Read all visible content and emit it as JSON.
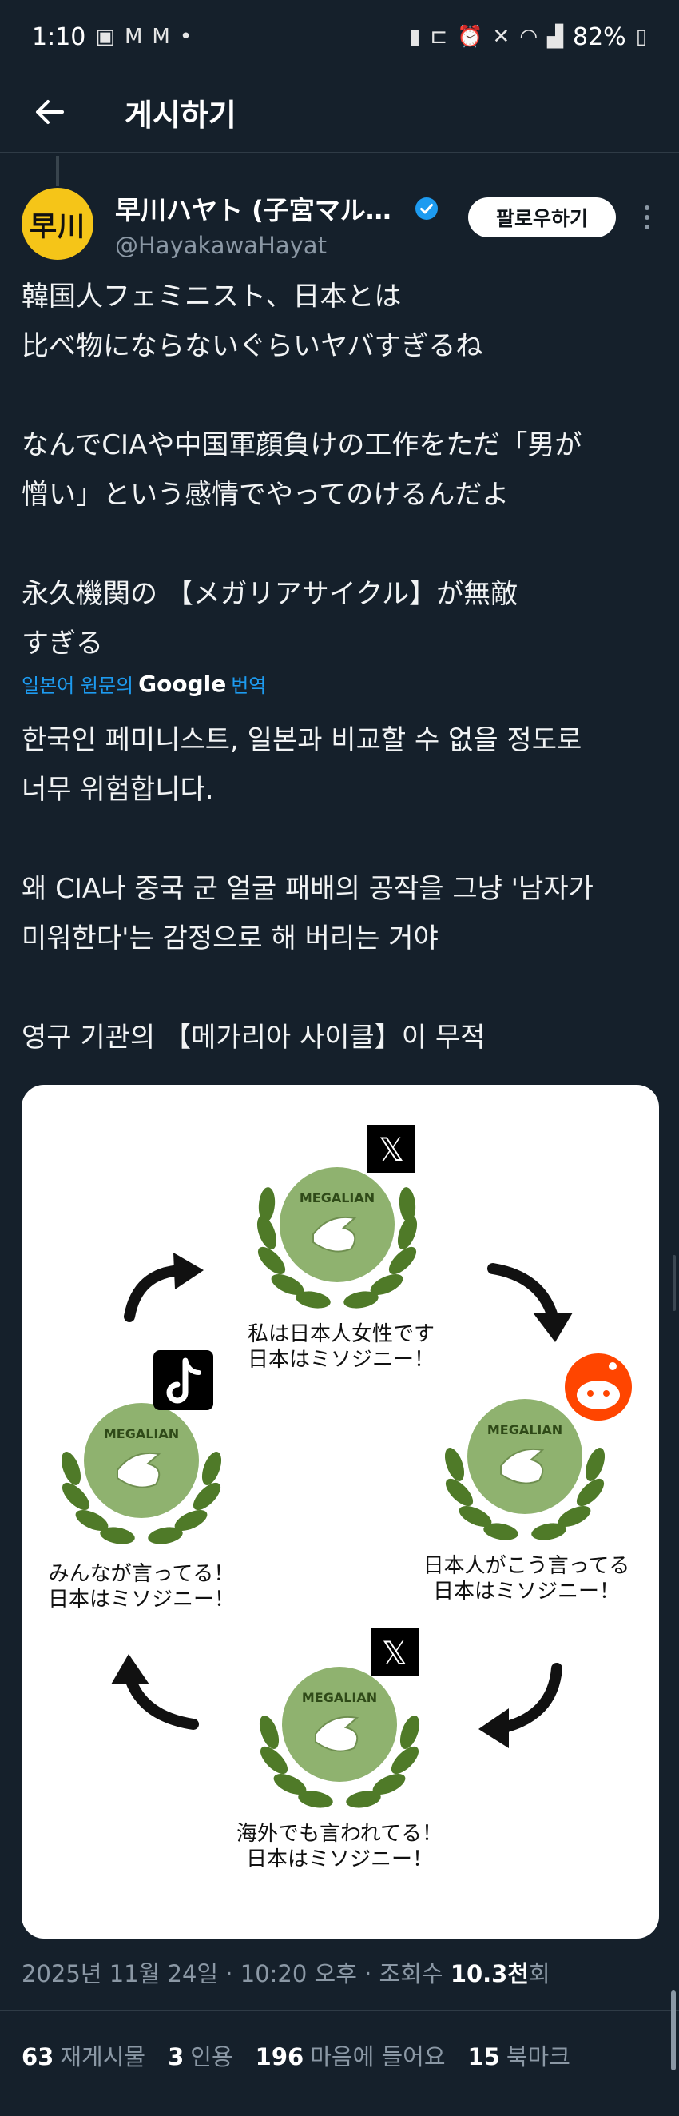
{
  "status_bar": {
    "time": "1:10",
    "icons_left": [
      "photo-icon",
      "gmail-icon",
      "gmail-icon",
      "dot-icon"
    ],
    "icons_right": [
      "battery-saver-icon",
      "bed-icon",
      "alarm-icon",
      "mute-icon",
      "wifi-icon",
      "signal-icon"
    ],
    "battery": "82%"
  },
  "header": {
    "title": "게시하기"
  },
  "author": {
    "avatar_text": "早川",
    "name": "早川ハヤト (子宮マルク…",
    "handle": "@HayakawaHayat",
    "follow_label": "팔로우하기"
  },
  "post": {
    "original": "韓国人フェミニスト、日本とは\n比べ物にならないぐらいヤバすぎるね\n\nなんでCIAや中国軍顔負けの工作をただ「男が\n憎い」という感情でやってのけるんだよ\n\n永久機関の 【メガリアサイクル】が無敵\nすぎる",
    "translate_prefix": "일본어 원문의",
    "translate_google": "Google",
    "translate_suffix": "번역",
    "translated": "한국인 페미니스트, 일본과 비교할 수 없을 정도로\n너무 위험합니다.\n\n왜 CIA나 중국 군 얼굴 패배의 공작을 그냥 '남자가\n미워한다'는 감정으로 해 버리는 거야\n\n영구 기관의 【메가리아 사이클】이 무적"
  },
  "image": {
    "badge_label": "MEGALIAN",
    "top_caption_1": "私は日本人女性です",
    "top_caption_2": "日本はミソジニー！",
    "right_caption_1": "日本人がこう言ってる",
    "right_caption_2": "日本はミソジニー！",
    "bottom_caption_1": "海外でも言われてる！",
    "bottom_caption_2": "日本はミソジニー！",
    "left_caption_1": "みんなが言ってる！",
    "left_caption_2": "日本はミソジニー！",
    "x_glyph": "𝕏",
    "colors": {
      "wreath": "#4f7a28",
      "badge": "#8fb26f",
      "arrow": "#111111",
      "reddit": "#ff4500"
    }
  },
  "meta": {
    "date": "2025년 11월 24일 · 10:20 오후 · 조회수 ",
    "views": "10.3천",
    "views_suffix": "회"
  },
  "stats": {
    "reposts_count": "63",
    "reposts_label": "재게시물",
    "quotes_count": "3",
    "quotes_label": "인용",
    "likes_count": "196",
    "likes_label": "마음에 들어요",
    "bookmarks_count": "15",
    "bookmarks_label": "북마크"
  },
  "colors": {
    "background": "#15202b",
    "accent": "#1d9bf0",
    "muted": "#8b98a5"
  }
}
